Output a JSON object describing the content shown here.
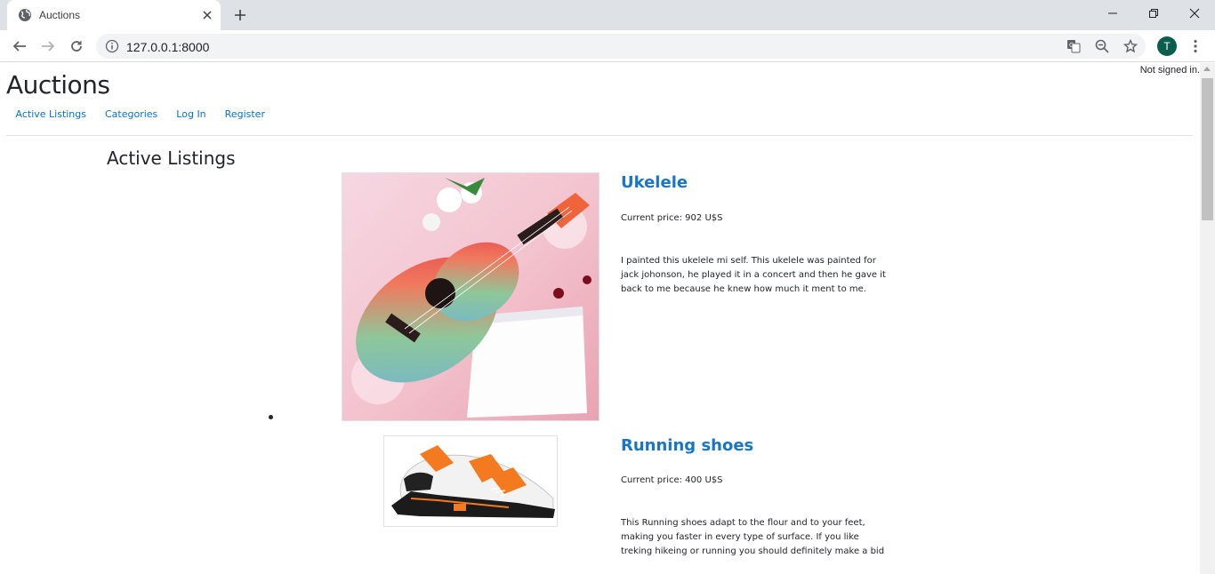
{
  "browser": {
    "tab_title": "Auctions",
    "url": "127.0.0.1:8000",
    "profile_initial": "T"
  },
  "page": {
    "signin_status": "Not signed in.",
    "site_title": "Auctions",
    "nav": [
      {
        "label": "Active Listings"
      },
      {
        "label": "Categories"
      },
      {
        "label": "Log In"
      },
      {
        "label": "Register"
      }
    ],
    "heading": "Active Listings"
  },
  "listings": [
    {
      "title": "Ukelele",
      "price": "Current price: 902 U$S",
      "description": "I painted this ukelele mi self. This ukelele was painted for jack johonson, he played it in a concert and then he gave it back to me because he knew how much it ment to me."
    },
    {
      "title": "Running shoes",
      "price": "Current price: 400 U$S",
      "description": "This Running shoes adapt to the flour and to your feet, making you faster in every type of surface. If you like treking hikeing or running you should definitely make a bid"
    }
  ],
  "colors": {
    "link": "#1976c7",
    "nav_link": "#0a72c8",
    "avatar": "#0b5e4b"
  }
}
